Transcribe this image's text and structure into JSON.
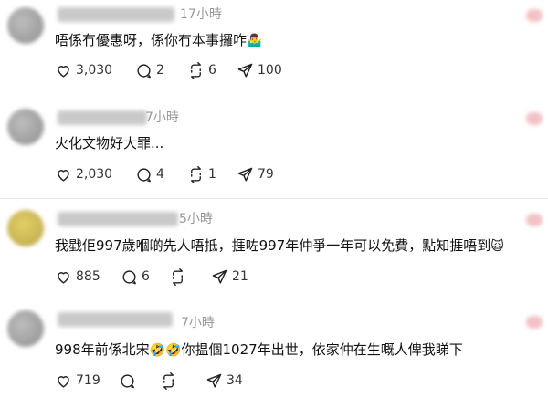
{
  "posts": [
    {
      "time": "17小時",
      "text": "唔係冇優惠呀，係你冇本事攞咋",
      "emoji": "🤷‍♂️",
      "likes": "3,030",
      "comments": "2",
      "reposts": "6",
      "shares": "100"
    },
    {
      "time": "7小時",
      "text": "火化文物好大罪...",
      "likes": "2,030",
      "comments": "4",
      "reposts": "1",
      "shares": "79"
    },
    {
      "time": "5小時",
      "text": "我戥佢997歲嗰啲先人唔抵，捱咗997年仲爭一年可以免費，點知捱唔到",
      "emoji": "🙀",
      "likes": "885",
      "comments": "6",
      "reposts": "0",
      "shares": "21"
    },
    {
      "time": "7小時",
      "text_before": "998年前係北宋",
      "emoji_mid": "🤣🤣",
      "text_after": "你揾個1027年出世，依家仲在生嘅人俾我睇下",
      "likes": "719",
      "comments": "0",
      "reposts": "0",
      "shares": "34"
    }
  ],
  "icons": {
    "like": "heart-icon",
    "comment": "comment-icon",
    "repost": "repost-icon",
    "share": "share-icon"
  }
}
